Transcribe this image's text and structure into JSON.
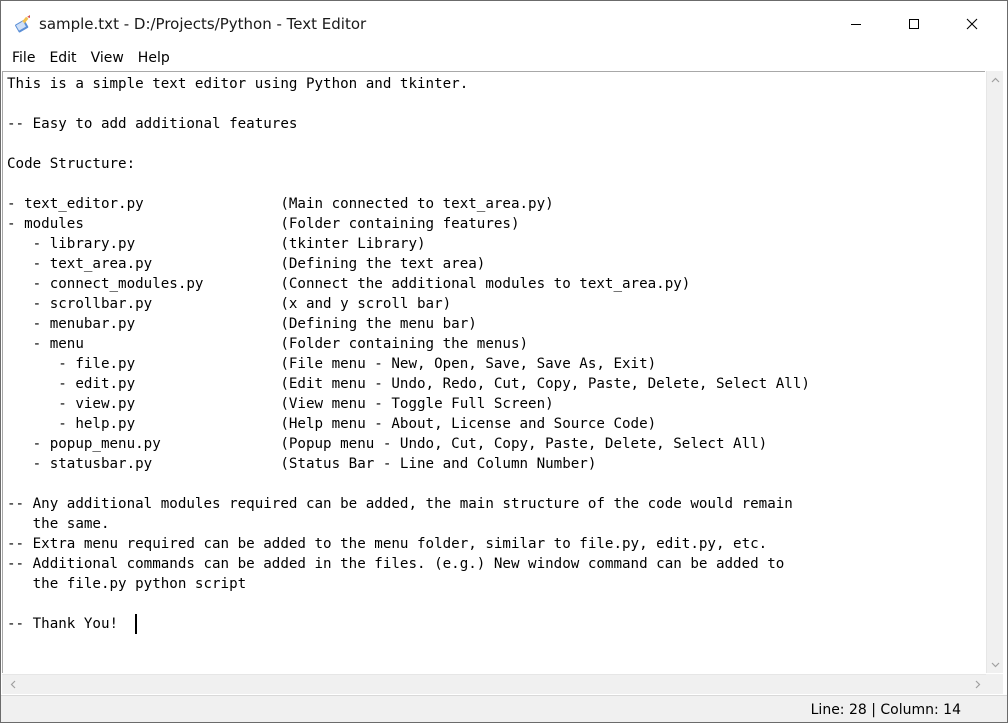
{
  "window": {
    "title": "sample.txt - D:/Projects/Python - Text Editor",
    "icon": "notepad-pencil-icon"
  },
  "menubar": {
    "items": [
      {
        "label": "File"
      },
      {
        "label": "Edit"
      },
      {
        "label": "View"
      },
      {
        "label": "Help"
      }
    ]
  },
  "editor": {
    "content": "This is a simple text editor using Python and tkinter.\n\n-- Easy to add additional features\n\nCode Structure:\n\n- text_editor.py                (Main connected to text_area.py)\n- modules                       (Folder containing features)\n   - library.py                 (tkinter Library)\n   - text_area.py               (Defining the text area)\n   - connect_modules.py         (Connect the additional modules to text_area.py)\n   - scrollbar.py               (x and y scroll bar)\n   - menubar.py                 (Defining the menu bar)\n   - menu                       (Folder containing the menus)\n      - file.py                 (File menu - New, Open, Save, Save As, Exit)\n      - edit.py                 (Edit menu - Undo, Redo, Cut, Copy, Paste, Delete, Select All)\n      - view.py                 (View menu - Toggle Full Screen)\n      - help.py                 (Help menu - About, License and Source Code)\n   - popup_menu.py              (Popup menu - Undo, Cut, Copy, Paste, Delete, Select All)\n   - statusbar.py               (Status Bar - Line and Column Number)\n\n-- Any additional modules required can be added, the main structure of the code would remain\n   the same.\n-- Extra menu required can be added to the menu folder, similar to file.py, edit.py, etc.\n-- Additional commands can be added in the files. (e.g.) New window command can be added to\n   the file.py python script\n\n-- Thank You!"
  },
  "statusbar": {
    "text": "Line: 28 | Column: 14"
  },
  "colors": {
    "window_bg": "#ffffff",
    "chrome_bg": "#f0f0f0",
    "border": "#a8a8a8"
  }
}
